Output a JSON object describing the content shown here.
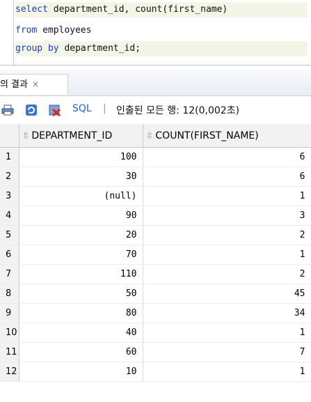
{
  "editor": {
    "lines": [
      {
        "kw": "select",
        "text": " department_id, count(first_name)"
      },
      {
        "kw": "from",
        "text": " employees"
      },
      {
        "kw": "group by",
        "text": " department_id;"
      }
    ]
  },
  "results_tab": {
    "label": "질의 결과",
    "close": "×"
  },
  "toolbar": {
    "sql_label": "SQL",
    "separator": "|",
    "status": "인출된 모든 행: 12(0,002초)"
  },
  "grid": {
    "columns": [
      "DEPARTMENT_ID",
      "COUNT(FIRST_NAME)"
    ],
    "rows": [
      {
        "n": "1",
        "dept": "100",
        "count": "6"
      },
      {
        "n": "2",
        "dept": "30",
        "count": "6"
      },
      {
        "n": "3",
        "dept": "(null)",
        "count": "1"
      },
      {
        "n": "4",
        "dept": "90",
        "count": "3"
      },
      {
        "n": "5",
        "dept": "20",
        "count": "2"
      },
      {
        "n": "6",
        "dept": "70",
        "count": "1"
      },
      {
        "n": "7",
        "dept": "110",
        "count": "2"
      },
      {
        "n": "8",
        "dept": "50",
        "count": "45"
      },
      {
        "n": "9",
        "dept": "80",
        "count": "34"
      },
      {
        "n": "10",
        "dept": "40",
        "count": "1"
      },
      {
        "n": "11",
        "dept": "60",
        "count": "7"
      },
      {
        "n": "12",
        "dept": "10",
        "count": "1"
      }
    ]
  }
}
